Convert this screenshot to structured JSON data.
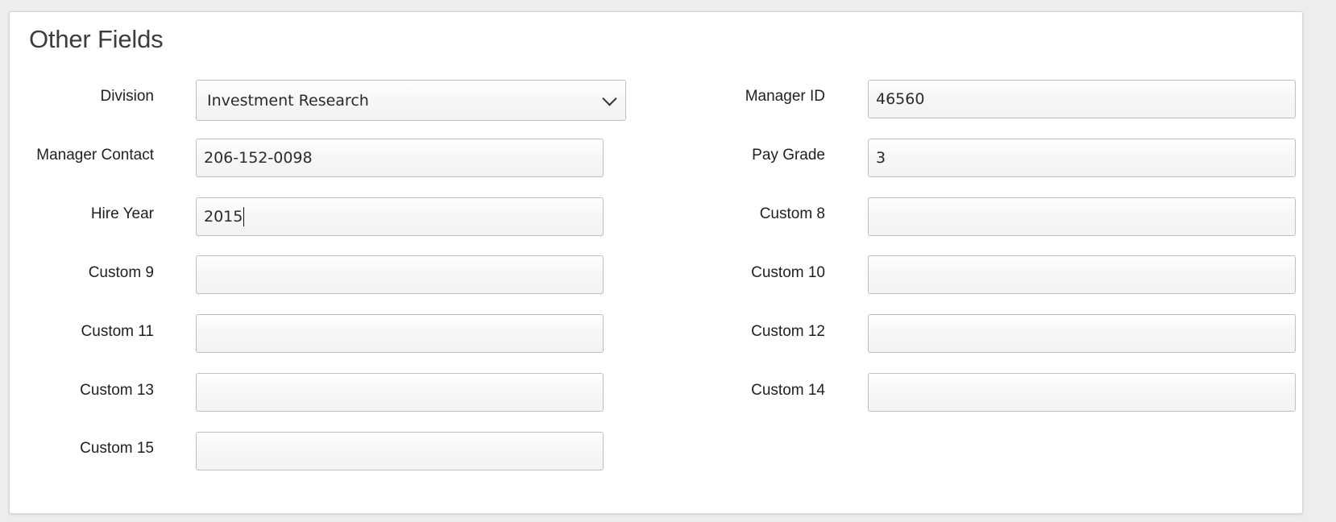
{
  "section": {
    "title": "Other Fields"
  },
  "fields": {
    "division": {
      "label": "Division",
      "value": "Investment Research",
      "type": "select"
    },
    "manager_id": {
      "label": "Manager ID",
      "value": "46560"
    },
    "manager_contact": {
      "label": "Manager Contact",
      "value": "206-152-0098"
    },
    "pay_grade": {
      "label": "Pay Grade",
      "value": "3"
    },
    "hire_year": {
      "label": "Hire Year",
      "value": "2015"
    },
    "custom_8": {
      "label": "Custom 8",
      "value": ""
    },
    "custom_9": {
      "label": "Custom 9",
      "value": ""
    },
    "custom_10": {
      "label": "Custom 10",
      "value": ""
    },
    "custom_11": {
      "label": "Custom 11",
      "value": ""
    },
    "custom_12": {
      "label": "Custom 12",
      "value": ""
    },
    "custom_13": {
      "label": "Custom 13",
      "value": ""
    },
    "custom_14": {
      "label": "Custom 14",
      "value": ""
    },
    "custom_15": {
      "label": "Custom 15",
      "value": ""
    }
  },
  "icons": {
    "division_dropdown": "chevron-down-icon"
  }
}
